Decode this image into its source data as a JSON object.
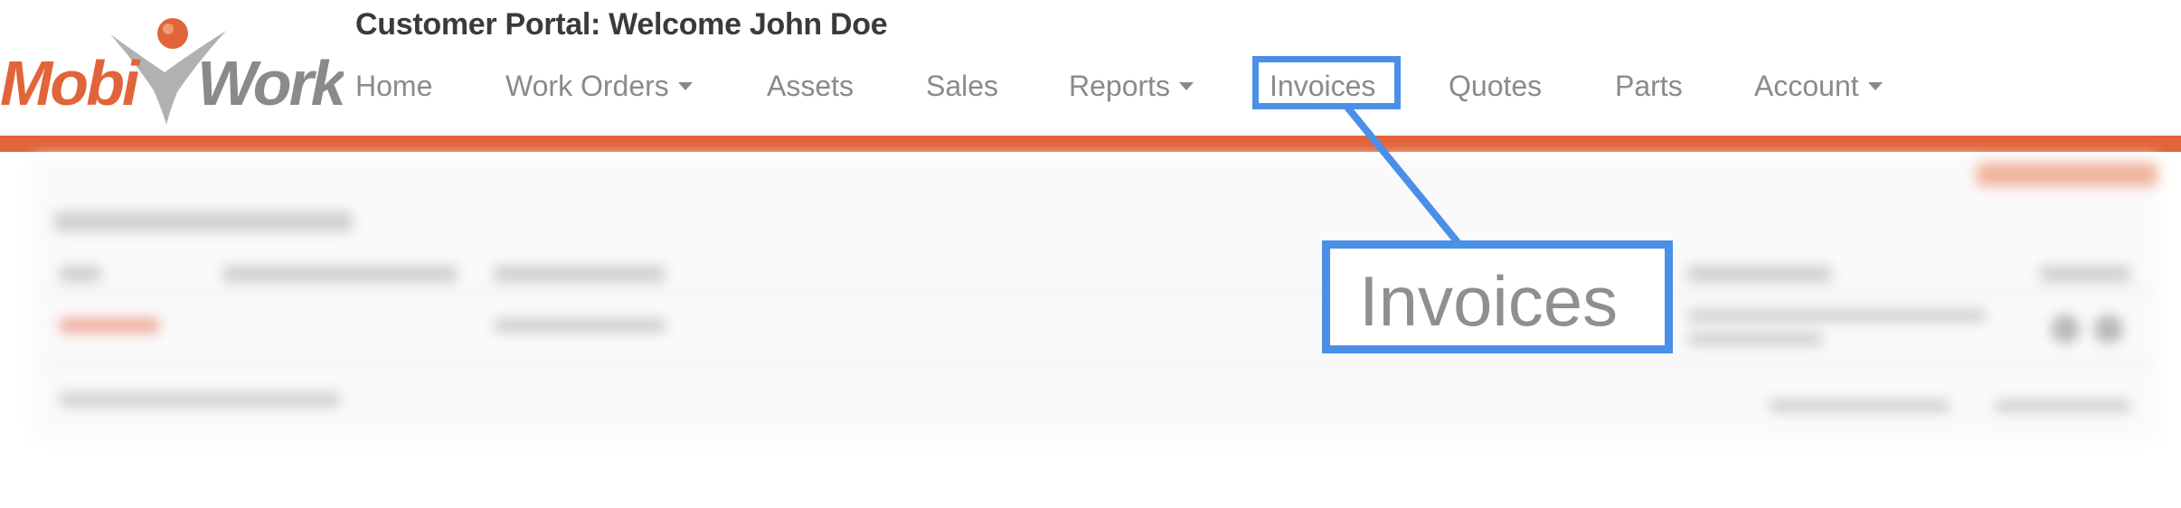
{
  "brand": {
    "logo_text_left": "Mobi",
    "logo_text_right": "Work",
    "colors": {
      "orange": "#e1653a",
      "gray": "#8a8a8a",
      "callout_blue": "#4a8fe8"
    }
  },
  "header": {
    "title": "Customer Portal: Welcome John Doe"
  },
  "nav": {
    "items": [
      {
        "label": "Home",
        "has_dropdown": false
      },
      {
        "label": "Work Orders",
        "has_dropdown": true
      },
      {
        "label": "Assets",
        "has_dropdown": false
      },
      {
        "label": "Sales",
        "has_dropdown": false
      },
      {
        "label": "Reports",
        "has_dropdown": true
      },
      {
        "label": "Invoices",
        "has_dropdown": false,
        "highlighted": true
      },
      {
        "label": "Quotes",
        "has_dropdown": false
      },
      {
        "label": "Parts",
        "has_dropdown": false
      },
      {
        "label": "Account",
        "has_dropdown": true
      }
    ]
  },
  "callout": {
    "label": "Invoices"
  }
}
